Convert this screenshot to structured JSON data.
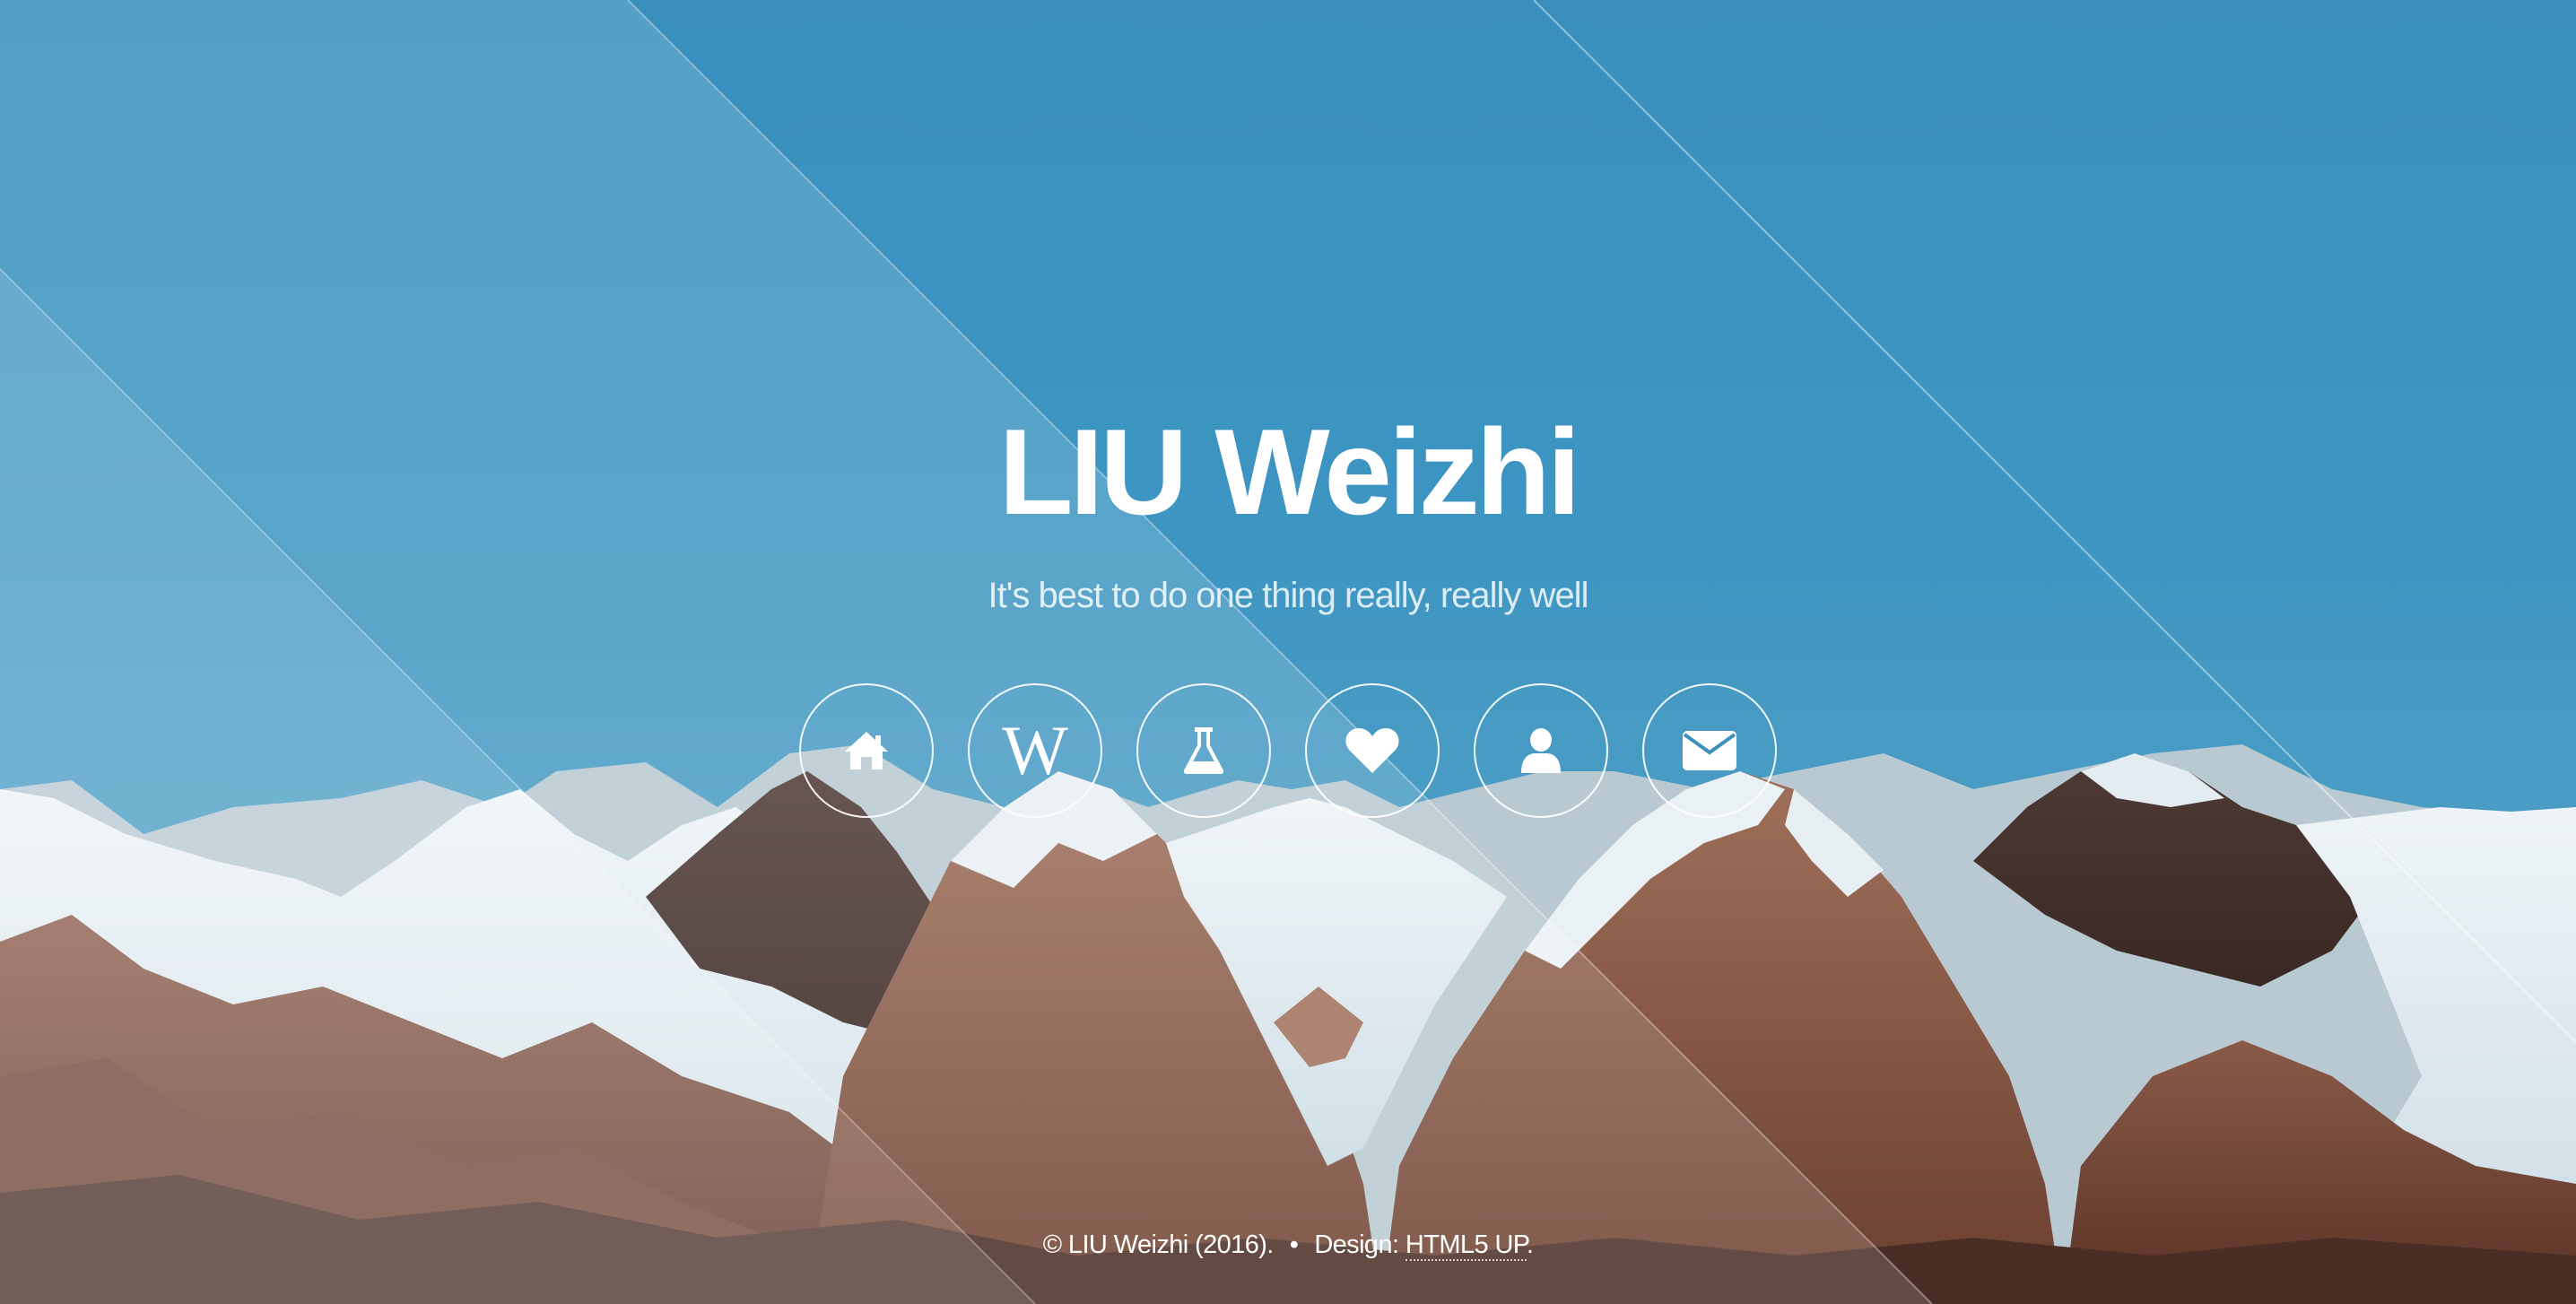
{
  "header": {
    "title": "LIU Weizhi",
    "subtitle": "It's best to do one thing really, really well"
  },
  "nav_icons": [
    {
      "icon": "home-icon"
    },
    {
      "icon": "wikipedia-icon",
      "glyph": "W"
    },
    {
      "icon": "flask-icon"
    },
    {
      "icon": "heart-icon"
    },
    {
      "icon": "user-icon"
    },
    {
      "icon": "envelope-icon"
    }
  ],
  "footer": {
    "copyright": "© LIU Weizhi (2016).",
    "separator": "•",
    "design_label": "Design:",
    "design_link": "HTML5 UP",
    "design_period": "."
  },
  "colors": {
    "sky": "#3a8fbd",
    "text": "#ffffff"
  }
}
